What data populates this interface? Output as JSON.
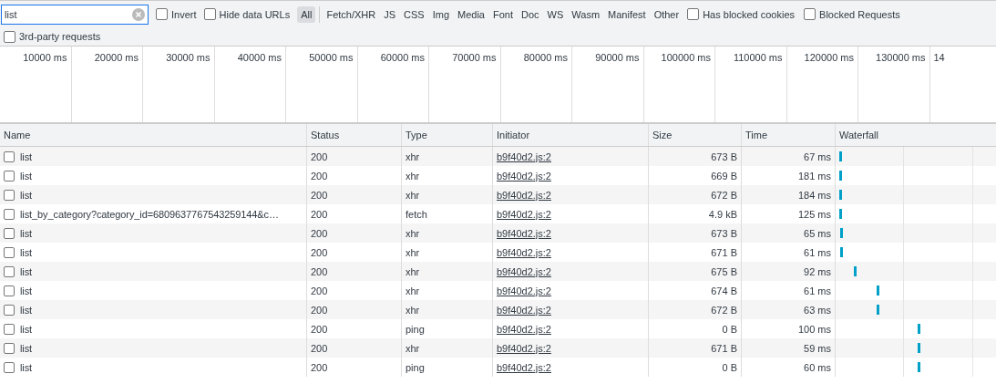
{
  "filter_bar": {
    "search": {
      "value": "list"
    },
    "options": [
      {
        "label": "Invert",
        "checked": false
      },
      {
        "label": "Hide data URLs",
        "checked": false
      }
    ],
    "types": [
      {
        "label": "All",
        "selected": true
      },
      {
        "label": "Fetch/XHR",
        "selected": false
      },
      {
        "label": "JS",
        "selected": false
      },
      {
        "label": "CSS",
        "selected": false
      },
      {
        "label": "Img",
        "selected": false
      },
      {
        "label": "Media",
        "selected": false
      },
      {
        "label": "Font",
        "selected": false
      },
      {
        "label": "Doc",
        "selected": false
      },
      {
        "label": "WS",
        "selected": false
      },
      {
        "label": "Wasm",
        "selected": false
      },
      {
        "label": "Manifest",
        "selected": false
      },
      {
        "label": "Other",
        "selected": false
      }
    ],
    "extra_options": [
      {
        "label": "Has blocked cookies",
        "checked": false
      },
      {
        "label": "Blocked Requests",
        "checked": false
      }
    ],
    "third_party": {
      "label": "3rd-party requests",
      "checked": false
    }
  },
  "overview": {
    "ticks": [
      "10000 ms",
      "20000 ms",
      "30000 ms",
      "40000 ms",
      "50000 ms",
      "60000 ms",
      "70000 ms",
      "80000 ms",
      "90000 ms",
      "100000 ms",
      "110000 ms",
      "120000 ms",
      "130000 ms",
      "14"
    ]
  },
  "table": {
    "columns": [
      "Name",
      "Status",
      "Type",
      "Initiator",
      "Size",
      "Time",
      "Waterfall"
    ],
    "rows": [
      {
        "name": "list",
        "checked": false,
        "status": "200",
        "type": "xhr",
        "initiator": "b9f40d2.js:2",
        "size": "673 B",
        "time": "67 ms"
      },
      {
        "name": "list",
        "checked": false,
        "status": "200",
        "type": "xhr",
        "initiator": "b9f40d2.js:2",
        "size": "669 B",
        "time": "181 ms"
      },
      {
        "name": "list",
        "checked": false,
        "status": "200",
        "type": "xhr",
        "initiator": "b9f40d2.js:2",
        "size": "672 B",
        "time": "184 ms"
      },
      {
        "name": "list_by_category?category_id=6809637767543259144&c…",
        "checked": false,
        "status": "200",
        "type": "fetch",
        "initiator": "b9f40d2.js:2",
        "size": "4.9 kB",
        "time": "125 ms"
      },
      {
        "name": "list",
        "checked": false,
        "status": "200",
        "type": "xhr",
        "initiator": "b9f40d2.js:2",
        "size": "673 B",
        "time": "65 ms"
      },
      {
        "name": "list",
        "checked": false,
        "status": "200",
        "type": "xhr",
        "initiator": "b9f40d2.js:2",
        "size": "671 B",
        "time": "61 ms"
      },
      {
        "name": "list",
        "checked": false,
        "status": "200",
        "type": "xhr",
        "initiator": "b9f40d2.js:2",
        "size": "675 B",
        "time": "92 ms"
      },
      {
        "name": "list",
        "checked": false,
        "status": "200",
        "type": "xhr",
        "initiator": "b9f40d2.js:2",
        "size": "674 B",
        "time": "61 ms"
      },
      {
        "name": "list",
        "checked": false,
        "status": "200",
        "type": "xhr",
        "initiator": "b9f40d2.js:2",
        "size": "672 B",
        "time": "63 ms"
      },
      {
        "name": "list",
        "checked": false,
        "status": "200",
        "type": "ping",
        "initiator": "b9f40d2.js:2",
        "size": "0 B",
        "time": "100 ms"
      },
      {
        "name": "list",
        "checked": false,
        "status": "200",
        "type": "xhr",
        "initiator": "b9f40d2.js:2",
        "size": "671 B",
        "time": "59 ms"
      },
      {
        "name": "list",
        "checked": false,
        "status": "200",
        "type": "ping",
        "initiator": "b9f40d2.js:2",
        "size": "0 B",
        "time": "60 ms"
      }
    ]
  }
}
